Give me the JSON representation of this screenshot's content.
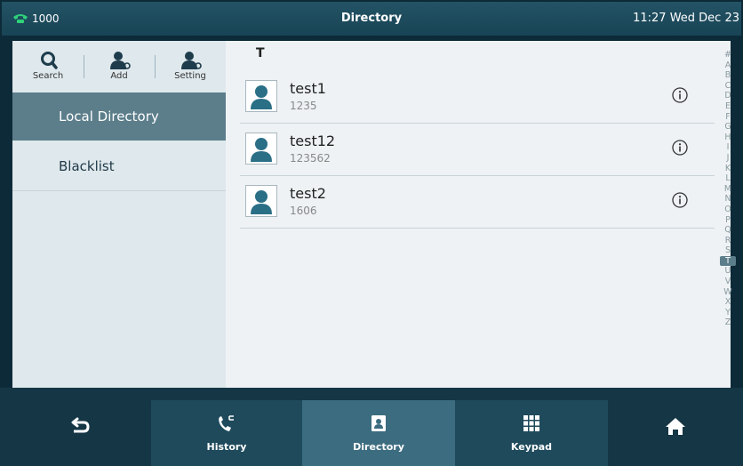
{
  "status_bar": {
    "account": "1000",
    "title": "Directory",
    "clock": "11:27 Wed Dec 23"
  },
  "toolbar": {
    "search_label": "Search",
    "add_label": "Add",
    "setting_label": "Setting"
  },
  "sidebar": {
    "items": [
      {
        "label": "Local Directory",
        "selected": true
      },
      {
        "label": "Blacklist",
        "selected": false
      }
    ]
  },
  "directory": {
    "group_letter": "T",
    "contacts": [
      {
        "name": "test1",
        "number": "1235"
      },
      {
        "name": "test12",
        "number": "123562"
      },
      {
        "name": "test2",
        "number": "1606"
      }
    ]
  },
  "alphabet_index": {
    "letters": [
      "#",
      "A",
      "B",
      "C",
      "D",
      "E",
      "F",
      "G",
      "H",
      "I",
      "J",
      "K",
      "L",
      "M",
      "N",
      "O",
      "P",
      "Q",
      "R",
      "S",
      "T",
      "U",
      "V",
      "W",
      "X",
      "Y",
      "Z"
    ],
    "active": "T"
  },
  "softkeys": {
    "history_label": "History",
    "directory_label": "Directory",
    "keypad_label": "Keypad"
  },
  "colors": {
    "accent": "#5c7e8b",
    "header": "#1d4a5b",
    "account_icon": "#2fd17a",
    "avatar_icon": "#2a6f86"
  }
}
